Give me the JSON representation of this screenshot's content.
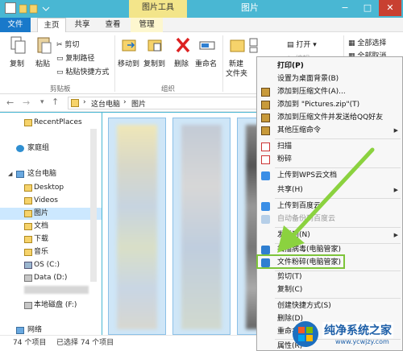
{
  "window": {
    "title": "图片",
    "contextual_group": "图片工具",
    "controls": [
      "−",
      "□",
      "✕"
    ]
  },
  "tabs": [
    {
      "label": "文件"
    },
    {
      "label": "主页"
    },
    {
      "label": "共享"
    },
    {
      "label": "查看"
    },
    {
      "label": "管理"
    }
  ],
  "ribbon": {
    "clipboard": {
      "copy": "复制",
      "paste": "粘贴",
      "cut": "剪切",
      "copy_path": "复制路径",
      "paste_shortcut": "粘贴快捷方式",
      "group": "剪贴板"
    },
    "organize": {
      "move_to": "移动到",
      "copy_to": "复制到",
      "delete": "删除",
      "rename": "重命名",
      "group": "组织"
    },
    "new": {
      "new_folder": "新建",
      "new_folder_line2": "文件夹"
    },
    "open": {
      "open": "打开",
      "edit": "编辑"
    },
    "select": {
      "select_all": "全部选择",
      "select_none": "全部取消"
    }
  },
  "address": {
    "this_pc": "这台电脑",
    "folder": "图片",
    "sep": "›"
  },
  "nav": {
    "items": [
      {
        "label": "RecentPlaces"
      },
      {
        "label": "家庭组"
      },
      {
        "label": "这台电脑"
      },
      {
        "label": "Desktop"
      },
      {
        "label": "Videos"
      },
      {
        "label": "图片"
      },
      {
        "label": "文档"
      },
      {
        "label": "下载"
      },
      {
        "label": "音乐"
      },
      {
        "label": "OS (C:)"
      },
      {
        "label": "Data (D:)"
      },
      {
        "label": "本地磁盘 (F:)"
      },
      {
        "label": "网络"
      }
    ]
  },
  "status": {
    "count": "74 个项目",
    "selected": "已选择 74 个项目"
  },
  "context_menu": {
    "items": [
      {
        "label": "打印(P)",
        "bold": true
      },
      {
        "label": "设置为桌面背景(B)"
      },
      {
        "label": "添加到压缩文件(A)..."
      },
      {
        "label": "添加到 \"Pictures.zip\"(T)"
      },
      {
        "label": "添加到压缩文件并发送给QQ好友"
      },
      {
        "label": "其他压缩命令",
        "arrow": "▶"
      },
      {
        "label": "扫描"
      },
      {
        "label": "粉碎"
      },
      {
        "label": "上传到WPS云文档"
      },
      {
        "label": "共享(H)",
        "arrow": "▶"
      },
      {
        "label": "上传到百度云"
      },
      {
        "label": "自动备份到百度云"
      },
      {
        "label": "发送到(N)",
        "arrow": "▶"
      },
      {
        "label": "扫描病毒(电脑管家)"
      },
      {
        "label": "文件粉碎(电脑管家)"
      },
      {
        "label": "剪切(T)"
      },
      {
        "label": "复制(C)"
      },
      {
        "label": "创建快捷方式(S)"
      },
      {
        "label": "删除(D)"
      },
      {
        "label": "重命名(M)"
      },
      {
        "label": "属性(R)"
      }
    ]
  },
  "watermark": {
    "title": "纯净系统之家",
    "url": "www.ycwjzy.com"
  },
  "colors": {
    "accent": "#1979ca",
    "title_bar": "#49b7d3",
    "highlight": "#7ec43a",
    "selection": "#cfe6f7"
  }
}
